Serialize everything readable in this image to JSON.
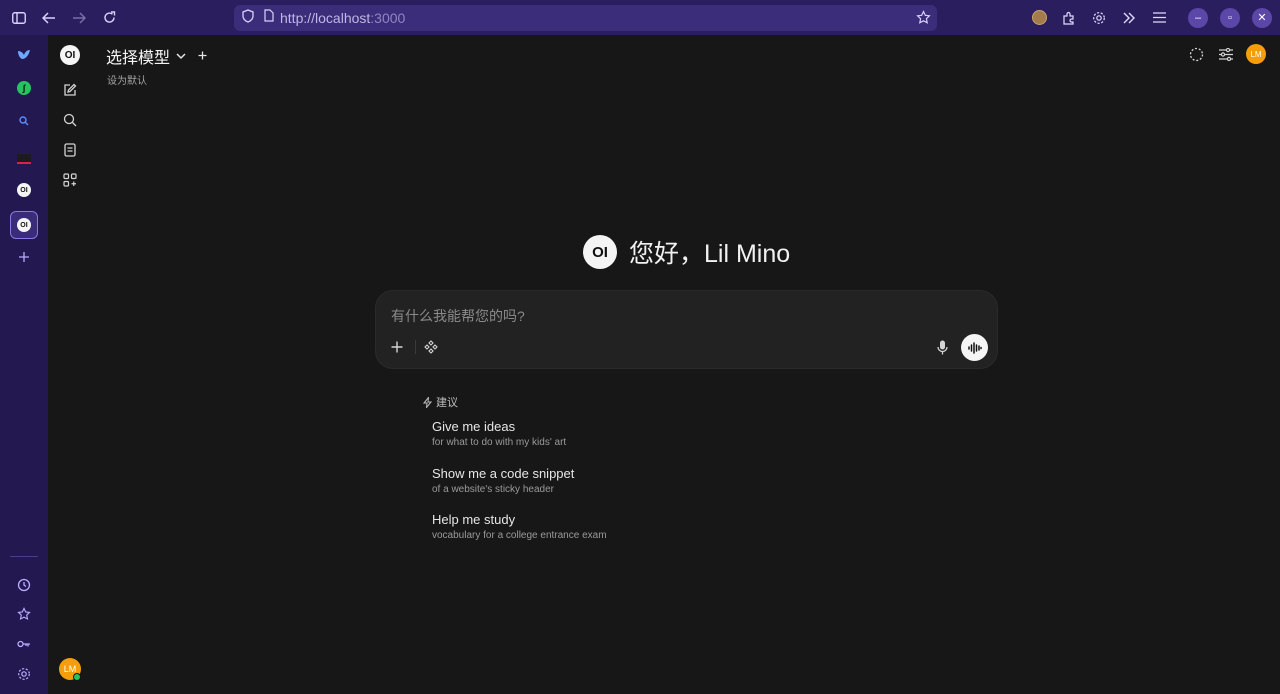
{
  "browser": {
    "url_host": "http://localhost",
    "url_port": ":3000"
  },
  "app": {
    "model_selector_label": "选择模型",
    "set_default_label": "设为默认",
    "greeting_prefix": "您好，",
    "user_name": "Lil Mino",
    "avatar_initials": "LM",
    "logo_text": "OI"
  },
  "composer": {
    "placeholder": "有什么我能帮您的吗?"
  },
  "suggestions": {
    "heading": "建议",
    "items": [
      {
        "title": "Give me ideas",
        "subtitle": "for what to do with my kids' art"
      },
      {
        "title": "Show me a code snippet",
        "subtitle": "of a website's sticky header"
      },
      {
        "title": "Help me study",
        "subtitle": "vocabulary for a college entrance exam"
      }
    ]
  },
  "colors": {
    "browser_bg": "#2b1e5e",
    "sidebar_bg": "#23184f",
    "app_bg": "#171717",
    "avatar": "#f59e0b",
    "online": "#22c55e"
  }
}
